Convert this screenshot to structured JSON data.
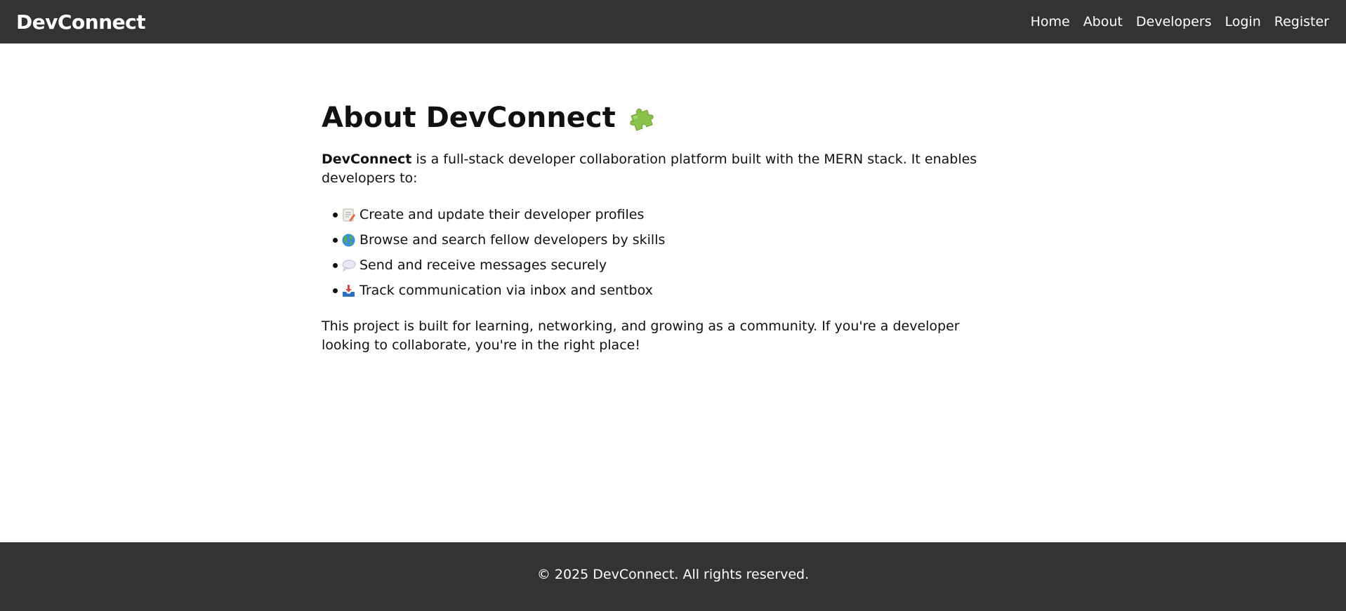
{
  "nav": {
    "brand": "DevConnect",
    "links": [
      "Home",
      "About",
      "Developers",
      "Login",
      "Register"
    ]
  },
  "main": {
    "title": "About DevConnect",
    "title_icon": "puzzle-piece-icon",
    "intro_bold": "DevConnect",
    "intro_rest": " is a full-stack developer collaboration platform built with the MERN stack. It enables developers to:",
    "features": [
      {
        "icon": "memo-icon",
        "text": "Create and update their developer profiles"
      },
      {
        "icon": "globe-icon",
        "text": "Browse and search fellow developers by skills"
      },
      {
        "icon": "speech-bubble-icon",
        "text": "Send and receive messages securely"
      },
      {
        "icon": "inbox-tray-icon",
        "text": "Track communication via inbox and sentbox"
      }
    ],
    "closing": "This project is built for learning, networking, and growing as a community. If you're a developer looking to collaborate, you're in the right place!"
  },
  "footer": {
    "text": "© 2025 DevConnect. All rights reserved."
  },
  "colors": {
    "bar_background": "#333333",
    "bar_text": "#ffffff",
    "page_background": "#ffffff"
  }
}
